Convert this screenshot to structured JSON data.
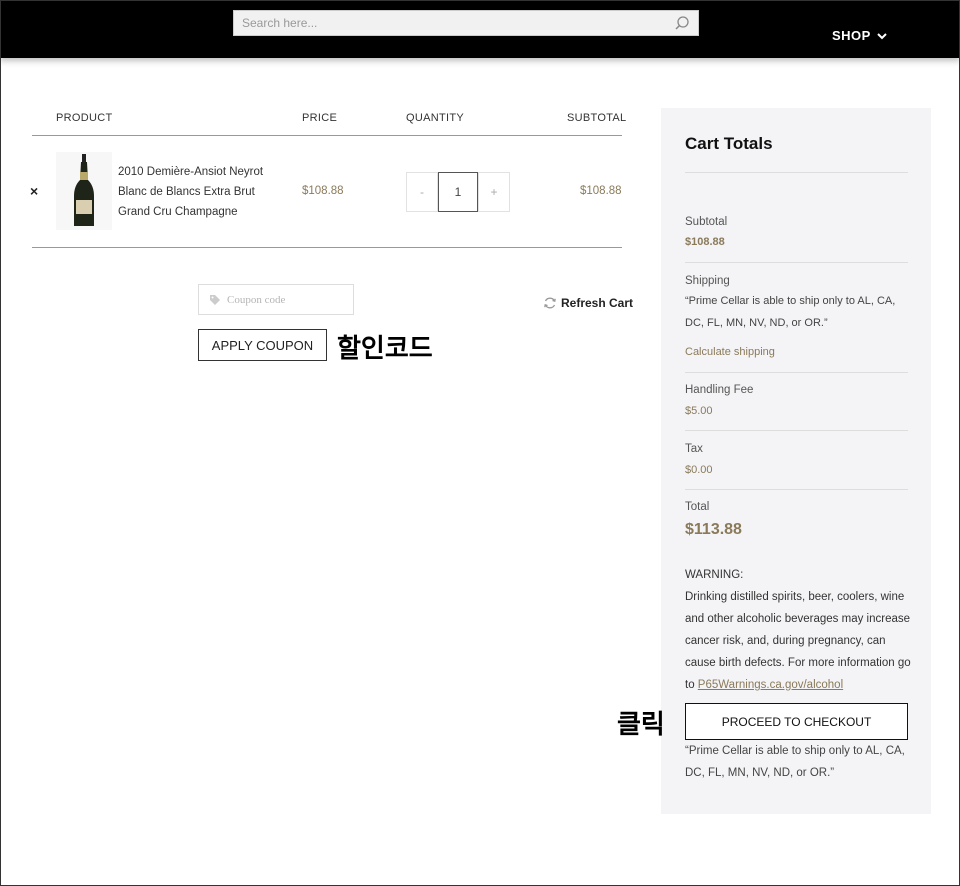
{
  "header": {
    "search_placeholder": "Search here...",
    "shop_label": "SHOP"
  },
  "cart": {
    "columns": [
      "PRODUCT",
      "PRICE",
      "QUANTITY",
      "SUBTOTAL"
    ],
    "items": [
      {
        "name": "2010 Demière-Ansiot Neyrot Blanc de Blancs Extra Brut Grand Cru Champagne",
        "price": "$108.88",
        "quantity": "1",
        "subtotal": "$108.88"
      }
    ],
    "qty_minus": "-",
    "qty_plus": "+",
    "remove_symbol": "×"
  },
  "coupon": {
    "placeholder": "Coupon code",
    "apply_label": "APPLY COUPON",
    "refresh_label": "Refresh Cart"
  },
  "annotations": {
    "coupon_note": "할인코드",
    "checkout_note": "클릭"
  },
  "totals": {
    "title": "Cart Totals",
    "subtotal_label": "Subtotal",
    "subtotal_value": "$108.88",
    "shipping_label": "Shipping",
    "shipping_note": "“Prime Cellar is able to ship only to AL, CA, DC, FL, MN, NV, ND, or OR.”",
    "calc_shipping": "Calculate shipping",
    "handling_label": "Handling Fee",
    "handling_value": "$5.00",
    "tax_label": "Tax",
    "tax_value": "$0.00",
    "total_label": "Total",
    "total_value": "$113.88",
    "warning_title": "WARNING:",
    "warning_text": "Drinking distilled spirits, beer, coolers, wine and other alcoholic beverages may increase cancer risk, and, during pregnancy, can cause birth defects. For more information go to ",
    "warning_link": "P65Warnings.ca.gov/alcohol",
    "checkout_label": "PROCEED TO CHECKOUT",
    "footer_note": "“Prime Cellar is able to ship only to AL, CA, DC, FL, MN, NV, ND, or OR.”"
  },
  "colors": {
    "accent": "#8a7a5a",
    "header_bg": "#000000",
    "panel_bg": "#f4f4f6"
  }
}
